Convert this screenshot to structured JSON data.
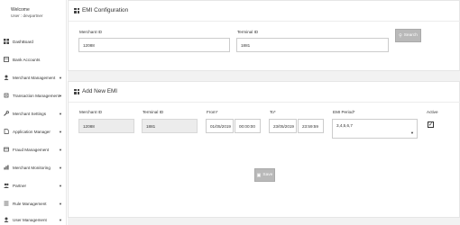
{
  "sidebar": {
    "welcome": "Welcome",
    "user": "User : devpartner",
    "items": [
      {
        "label": "DashBoard",
        "icon": "dashboard-icon",
        "has_caret": false
      },
      {
        "label": "Bank Accounts",
        "icon": "bank-icon",
        "has_caret": false
      },
      {
        "label": "Merchant Management",
        "icon": "merchant-icon",
        "has_caret": true
      },
      {
        "label": "Transaction Management",
        "icon": "transaction-icon",
        "has_caret": true
      },
      {
        "label": "Merchant Settings",
        "icon": "wrench-icon",
        "has_caret": true
      },
      {
        "label": "Application Manager",
        "icon": "application-icon",
        "has_caret": true
      },
      {
        "label": "Fraud Management",
        "icon": "fraud-icon",
        "has_caret": true
      },
      {
        "label": "Merchant Monitoring",
        "icon": "monitoring-icon",
        "has_caret": true
      },
      {
        "label": "Partner",
        "icon": "partner-icon",
        "has_caret": true
      },
      {
        "label": "Rule Management",
        "icon": "rule-icon",
        "has_caret": true
      },
      {
        "label": "User Management",
        "icon": "user-management-icon",
        "has_caret": true
      }
    ]
  },
  "emi_config": {
    "title": "EMI Configuration",
    "merchant_id_label": "Merchant ID",
    "merchant_id_value": "12088",
    "terminal_id_label": "Terminal ID",
    "terminal_id_value": "1881",
    "search_label": "Search"
  },
  "add_emi": {
    "title": "Add New EMI",
    "merchant_id_label": "Merchant ID",
    "merchant_id_value": "12088",
    "terminal_id_label": "Terminal ID",
    "terminal_id_value": "1881",
    "from_label": "From*",
    "from_date": "01/05/2019",
    "from_time": "00:00:00",
    "to_label": "To*",
    "to_date": "23/05/2019",
    "to_time": "23:59:59",
    "emi_period_label": "EMI Period*",
    "emi_period_value": "3,4,5,6,7",
    "active_label": "Active",
    "active_checked": true,
    "save_label": "Save"
  },
  "colors": {
    "sidebar_bg": "#ffffff",
    "main_bg": "#f2f2f2",
    "button_bg": "#b9b9b9"
  }
}
